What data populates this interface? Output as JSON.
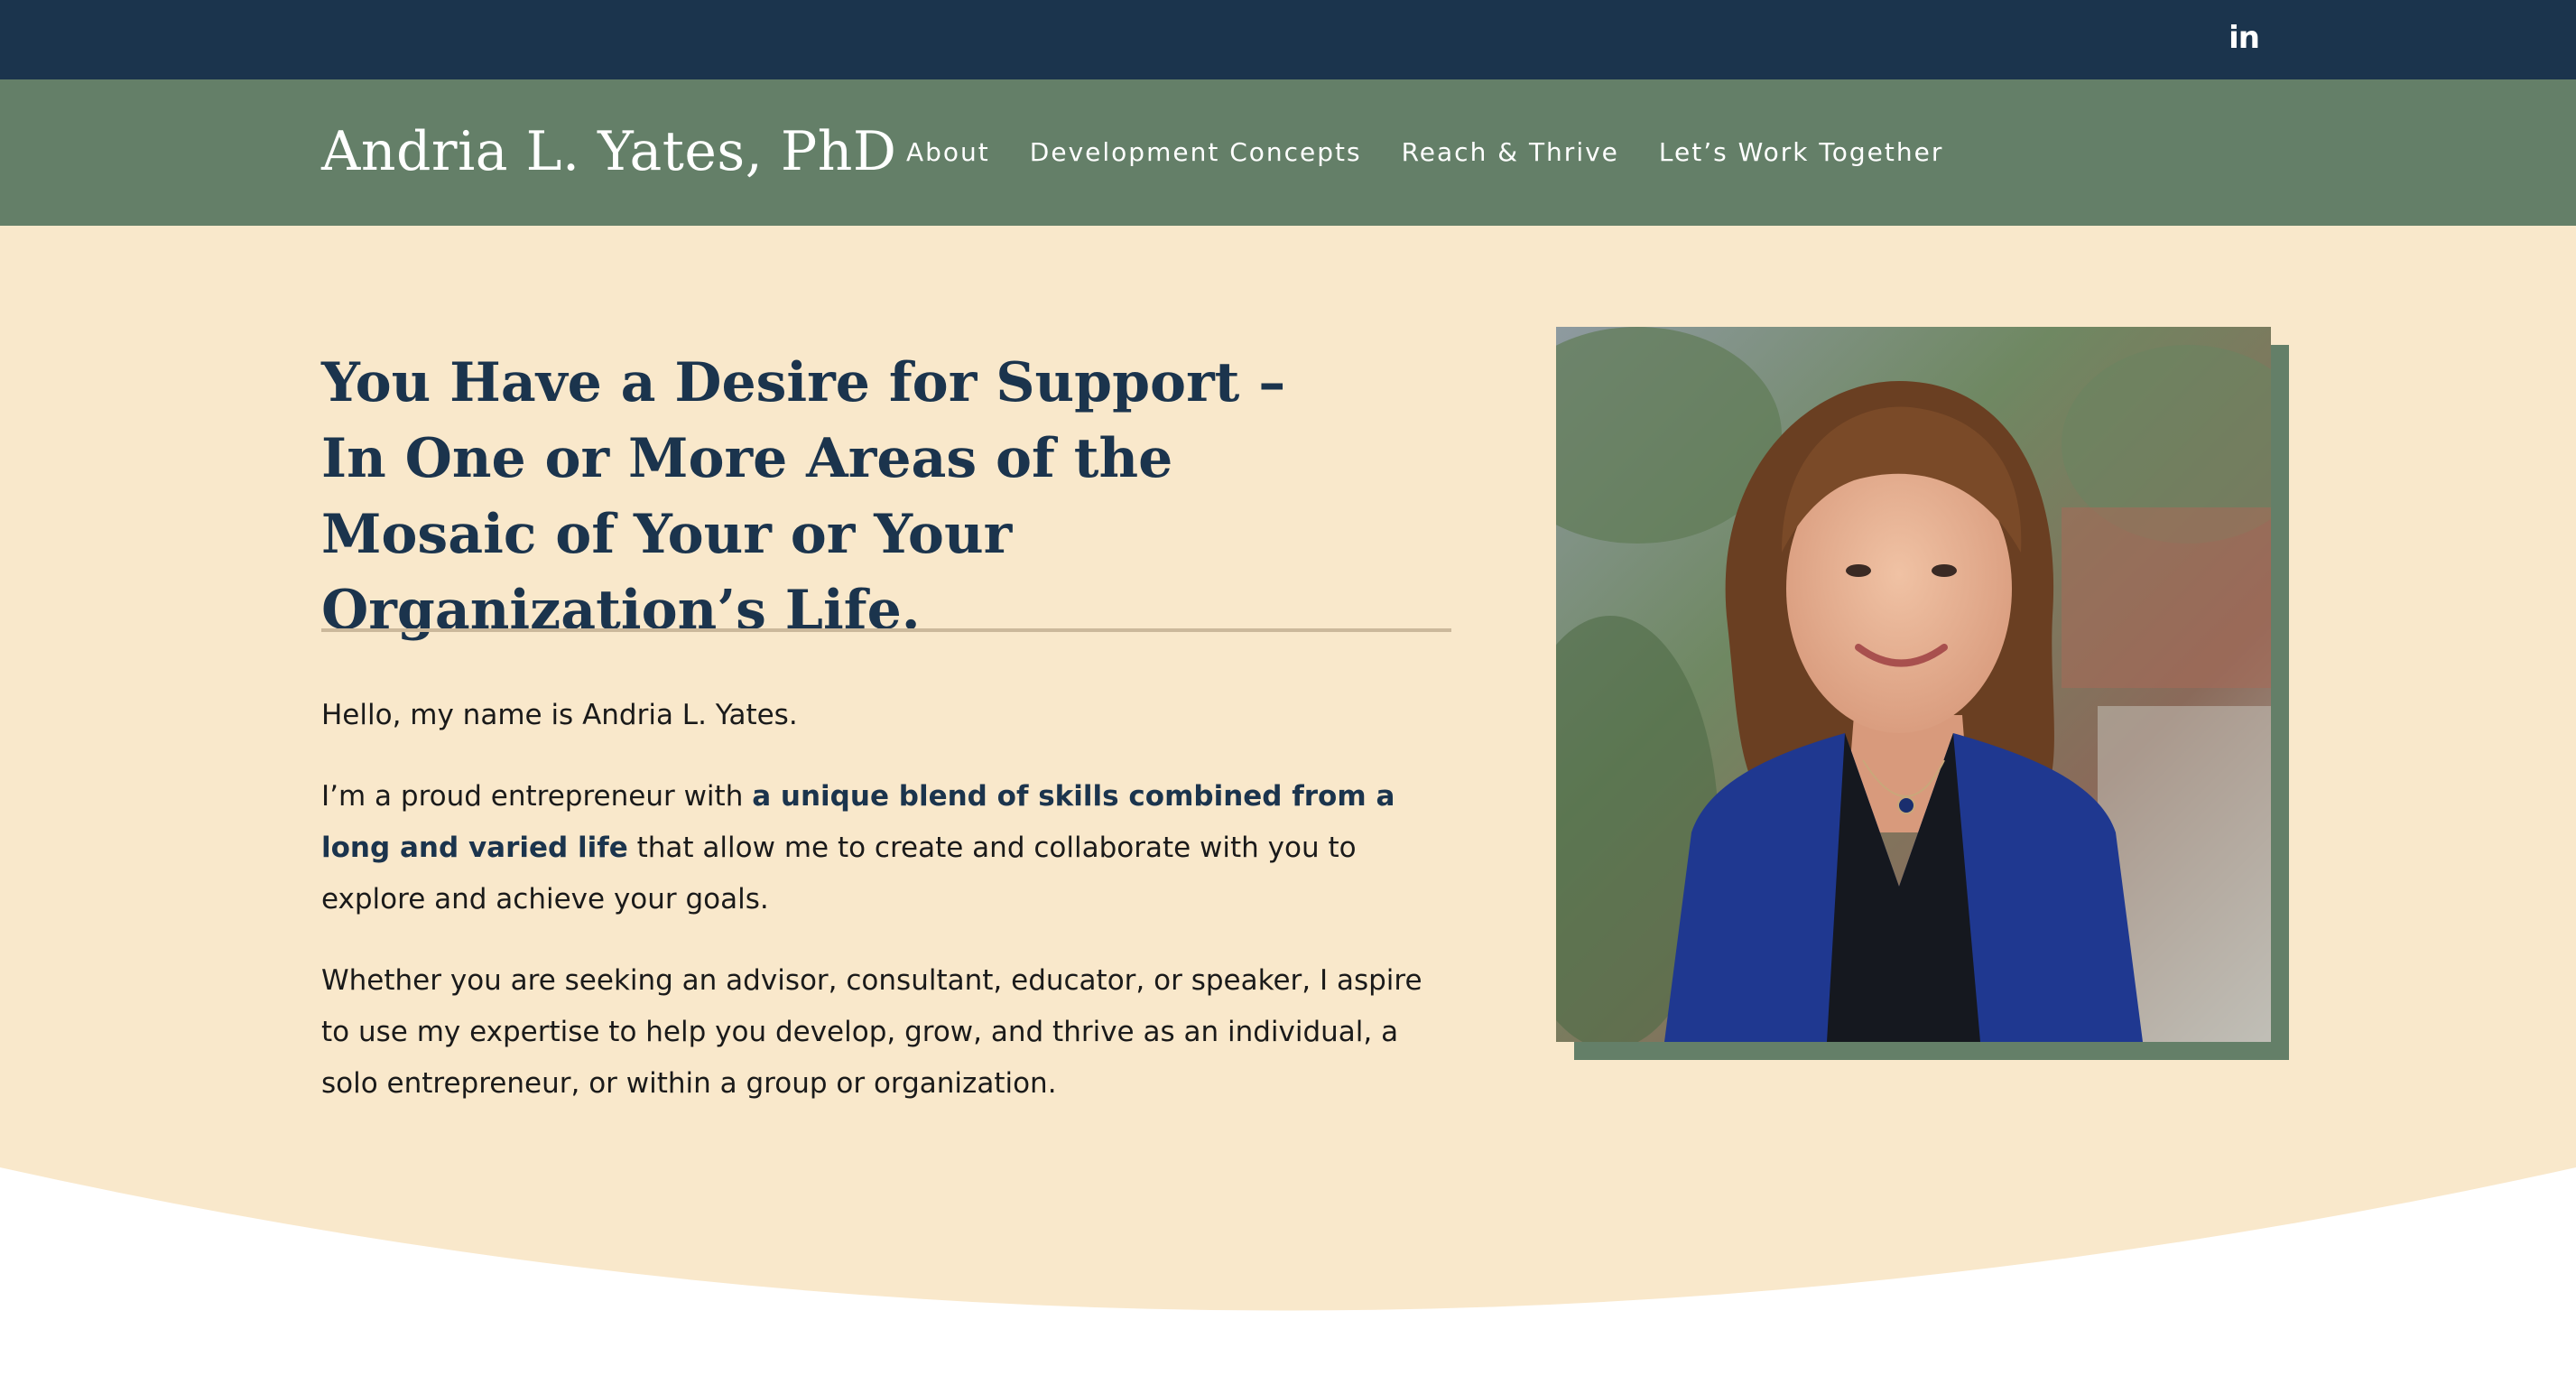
{
  "topbar": {
    "social_icon": "linkedin-icon",
    "social_glyph": "in"
  },
  "header": {
    "site_title": "Andria L. Yates, PhD",
    "nav": [
      "About",
      "Development Concepts",
      "Reach & Thrive",
      "Let’s Work Together"
    ]
  },
  "hero": {
    "headline_bold": "You Have a Desire for Support",
    "headline_rest": " – In One or More Areas of the Mosaic of Your or Your Organization’s Life.",
    "intro": "Hello, my name is Andria L. Yates.",
    "p2_before": "I’m a proud entrepreneur with ",
    "p2_emphasis": "a unique blend of skills combined from a long and varied life",
    "p2_after": " that allow me to create and collaborate with you to explore and achieve your goals.",
    "p3": "Whether you are seeking an advisor, consultant, educator, or speaker, I aspire to use my expertise to help you develop, grow, and thrive as an individual, a solo entrepreneur, or within a group or organization."
  },
  "colors": {
    "topbar": "#1b344d",
    "header": "#647f68",
    "hero_bg": "#f9e8cb",
    "heading": "#1b344d",
    "photo_frame": "#647f68"
  }
}
